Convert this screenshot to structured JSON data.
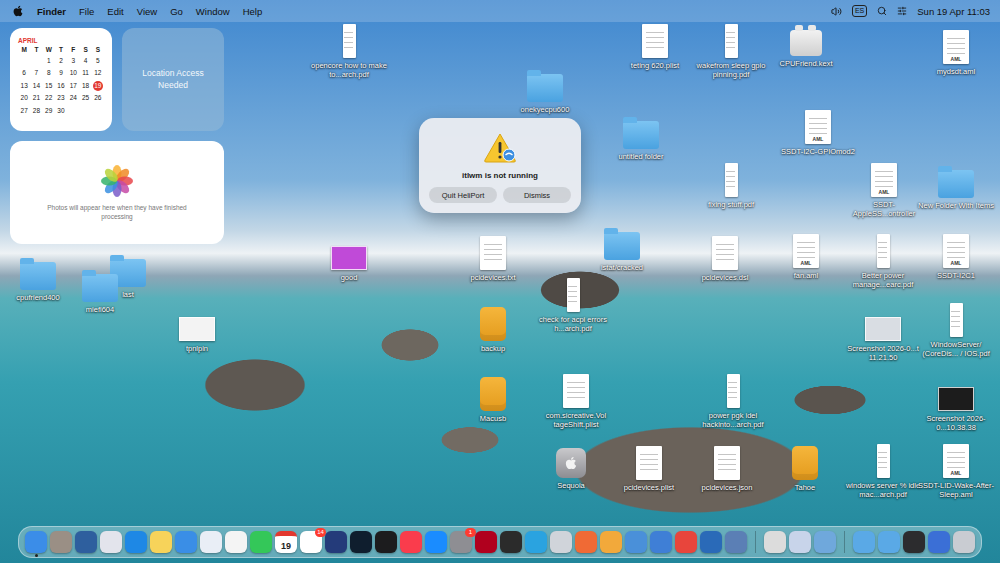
{
  "menu_bar": {
    "app": "Finder",
    "items": [
      "File",
      "Edit",
      "View",
      "Go",
      "Window",
      "Help"
    ],
    "input_source": "ES",
    "clock": "Sun 19 Apr 11:03"
  },
  "widgets": {
    "calendar": {
      "month": "APRIL",
      "weekdays": [
        "M",
        "T",
        "W",
        "T",
        "F",
        "S",
        "S"
      ],
      "weeks": [
        [
          {
            "day": "",
            "selected": false
          },
          {
            "day": "",
            "selected": false
          },
          {
            "day": "1",
            "selected": false
          },
          {
            "day": "2",
            "selected": false
          },
          {
            "day": "3",
            "selected": false
          },
          {
            "day": "4",
            "selected": false
          },
          {
            "day": "5",
            "selected": false
          }
        ],
        [
          {
            "day": "6",
            "selected": false
          },
          {
            "day": "7",
            "selected": false
          },
          {
            "day": "8",
            "selected": false
          },
          {
            "day": "9",
            "selected": false
          },
          {
            "day": "10",
            "selected": false
          },
          {
            "day": "11",
            "selected": false
          },
          {
            "day": "12",
            "selected": false
          }
        ],
        [
          {
            "day": "13",
            "selected": false
          },
          {
            "day": "14",
            "selected": false
          },
          {
            "day": "15",
            "selected": false
          },
          {
            "day": "16",
            "selected": false
          },
          {
            "day": "17",
            "selected": false
          },
          {
            "day": "18",
            "selected": false
          },
          {
            "day": "19",
            "selected": true
          }
        ],
        [
          {
            "day": "20",
            "selected": false
          },
          {
            "day": "21",
            "selected": false
          },
          {
            "day": "22",
            "selected": false
          },
          {
            "day": "23",
            "selected": false
          },
          {
            "day": "24",
            "selected": false
          },
          {
            "day": "25",
            "selected": false
          },
          {
            "day": "26",
            "selected": false
          }
        ],
        [
          {
            "day": "27",
            "selected": false
          },
          {
            "day": "28",
            "selected": false
          },
          {
            "day": "29",
            "selected": false
          },
          {
            "day": "30",
            "selected": false
          },
          {
            "day": "",
            "selected": false
          },
          {
            "day": "",
            "selected": false
          },
          {
            "day": "",
            "selected": false
          }
        ]
      ]
    },
    "location": {
      "text": "Location Access Needed"
    },
    "photos": {
      "text": "Photos will appear here when they have finished processing"
    }
  },
  "alert": {
    "title": "itlwm is not running",
    "buttons": [
      {
        "label": "Quit HeliPort"
      },
      {
        "label": "Dismiss"
      }
    ]
  },
  "desktop_icons": [
    {
      "label": "opencore how to make to...arch.pdf",
      "kind": "pdf"
    },
    {
      "label": "teting 620.plist",
      "kind": "doc"
    },
    {
      "label": "wakefrom sleep gpio pinning.pdf",
      "kind": "pdf"
    },
    {
      "label": "CPUFriend.kext",
      "kind": "kext"
    },
    {
      "label": "mydsdt.aml",
      "kind": "aml",
      "tag": "AML"
    },
    {
      "label": "onekyecpu600",
      "kind": "folder"
    },
    {
      "label": "untitled folder",
      "kind": "folder"
    },
    {
      "label": "SSDT-I2C-GPIOmod2",
      "kind": "aml",
      "tag": "AML"
    },
    {
      "label": "fixing stuff.pdf",
      "kind": "pdf"
    },
    {
      "label": "SSDT-AppleSS...ontroller",
      "kind": "aml",
      "tag": "AML"
    },
    {
      "label": "New Folder With Items",
      "kind": "folder"
    },
    {
      "label": "cpufriend400",
      "kind": "folder"
    },
    {
      "label": "last",
      "kind": "folder"
    },
    {
      "label": "miefi604",
      "kind": "folder"
    },
    {
      "label": "good",
      "kind": "image",
      "color": "#c04ad8"
    },
    {
      "label": "pcidevices.txt",
      "kind": "doc"
    },
    {
      "label": "istat/cracked",
      "kind": "folder"
    },
    {
      "label": "pcidevices.dsl",
      "kind": "doc"
    },
    {
      "label": "fan.aml",
      "kind": "aml",
      "tag": "AML"
    },
    {
      "label": "Better power manage...earc.pdf",
      "kind": "pdf"
    },
    {
      "label": "SSDT-I2C1",
      "kind": "aml",
      "tag": "AML"
    },
    {
      "label": "tpnlpin",
      "kind": "image",
      "color": "#f3f3f3"
    },
    {
      "label": "check for acpi errors h...arch.pdf",
      "kind": "pdf"
    },
    {
      "label": "backup",
      "kind": "disk"
    },
    {
      "label": "Screenshot 2026-0...t 11.21.50",
      "kind": "image",
      "color": "#d9dde3"
    },
    {
      "label": "WindowServer/ (CoreDis... / IOS.pdf",
      "kind": "pdf"
    },
    {
      "label": "Macusb",
      "kind": "disk"
    },
    {
      "label": "com.sicreative.Vol tageShift.plist",
      "kind": "doc"
    },
    {
      "label": "power pgk idel hackinto...arch.pdf",
      "kind": "pdf"
    },
    {
      "label": "Screenshot 2026-0...10.38.38",
      "kind": "image",
      "color": "#1c1c1c"
    },
    {
      "label": "Sequoia",
      "kind": "installer"
    },
    {
      "label": "pcidevices.plist",
      "kind": "doc"
    },
    {
      "label": "pcidevices.json",
      "kind": "doc"
    },
    {
      "label": "Tahoe",
      "kind": "disk"
    },
    {
      "label": "windows server % idle mac...arch.pdf",
      "kind": "pdf"
    },
    {
      "label": "SSDT-LID-Wake-After-Sleep.aml",
      "kind": "aml",
      "tag": "AML"
    }
  ],
  "dock": {
    "groups": [
      {
        "items": [
          {
            "color": "#3b8de8",
            "running": true
          },
          {
            "color": "#9a8f85",
            "running": false
          },
          {
            "color": "#2e5f9e",
            "running": false
          },
          {
            "color": "#e3e4ec",
            "running": false
          },
          {
            "color": "#1e88e5",
            "running": false
          },
          {
            "color": "#f7d35a",
            "running": false
          },
          {
            "color": "#3a8ee6",
            "running": false
          },
          {
            "color": "#e9eef6",
            "running": false
          },
          {
            "color": "#f4f4f4",
            "running": false
          },
          {
            "color": "#34c759",
            "running": false
          },
          {
            "color": "#ffffff",
            "running": false,
            "text": "19"
          },
          {
            "color": "#ffffff",
            "running": false,
            "badge": "14"
          },
          {
            "color": "#243b7a",
            "running": false
          },
          {
            "color": "#0f1e2e",
            "running": false
          },
          {
            "color": "#1c1c1e",
            "running": false
          },
          {
            "color": "#fa3c4c",
            "running": false
          },
          {
            "color": "#1a8cff",
            "running": false
          },
          {
            "color": "#8e8e93",
            "running": false,
            "badge": "1"
          },
          {
            "color": "#b0001e",
            "running": false
          },
          {
            "color": "#2b2b2b",
            "running": false
          },
          {
            "color": "#2aa3e0",
            "running": false
          },
          {
            "color": "#d0d4da",
            "running": false
          },
          {
            "color": "#f06a35",
            "running": false
          },
          {
            "color": "#f2a93b",
            "running": false
          },
          {
            "color": "#4a90d9",
            "running": false
          },
          {
            "color": "#3f7fd6",
            "running": false
          },
          {
            "color": "#e8453c",
            "running": false
          },
          {
            "color": "#2a6ab8",
            "running": false
          },
          {
            "color": "#5b7fb5",
            "running": false
          }
        ]
      },
      {
        "items": [
          {
            "color": "#dcdcdc",
            "running": false
          },
          {
            "color": "#c8d4ea",
            "running": false
          },
          {
            "color": "#6fa8dc",
            "running": false
          }
        ]
      },
      {
        "items": [
          {
            "color": "#5aa9e6",
            "running": false
          },
          {
            "color": "#5aa9e6",
            "running": false
          },
          {
            "color": "#2c2c2e",
            "running": false
          },
          {
            "color": "#3b6fd6",
            "running": false
          },
          {
            "color": "#c9ccd2",
            "running": false
          }
        ]
      }
    ]
  }
}
